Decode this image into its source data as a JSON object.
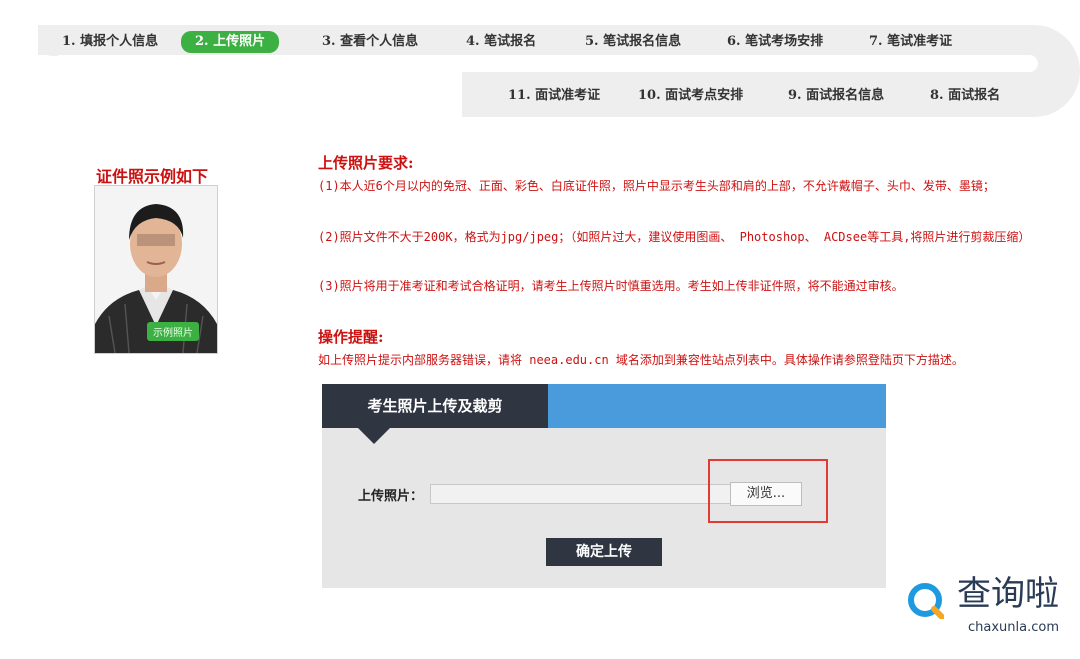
{
  "steps": [
    {
      "label": "1. 填报个人信息",
      "active": false
    },
    {
      "label": "2. 上传照片",
      "active": true
    },
    {
      "label": "3. 查看个人信息",
      "active": false
    },
    {
      "label": "4. 笔试报名",
      "active": false
    },
    {
      "label": "5. 笔试报名信息",
      "active": false
    },
    {
      "label": "6. 笔试考场安排",
      "active": false
    },
    {
      "label": "7. 笔试准考证",
      "active": false
    },
    {
      "label": "8. 面试报名",
      "active": false
    },
    {
      "label": "9. 面试报名信息",
      "active": false
    },
    {
      "label": "10. 面试考点安排",
      "active": false
    },
    {
      "label": "11. 面试准考证",
      "active": false
    }
  ],
  "sample": {
    "title": "证件照示例如下",
    "photo_label": "示例照片"
  },
  "requirements": {
    "title": "上传照片要求:",
    "items": [
      "(1)本人近6个月以内的免冠、正面、彩色、白底证件照，照片中显示考生头部和肩的上部，不允许戴帽子、头巾、发带、墨镜；",
      "(2)照片文件不大于200K，格式为jpg/jpeg；（如照片过大，建议使用图画、 Photoshop、 ACDsee等工具,将照片进行剪裁压缩）",
      "(3)照片将用于准考证和考试合格证明，请考生上传照片时慎重选用。考生如上传非证件照，将不能通过审核。"
    ]
  },
  "tip": {
    "title": "操作提醒:",
    "text": "如上传照片提示内部服务器错误，请将 neea.edu.cn 域名添加到兼容性站点列表中。具体操作请参照登陆页下方描述。"
  },
  "upload_panel": {
    "tab_title": "考生照片上传及裁剪",
    "field_label": "上传照片：",
    "file_value": "",
    "browse_label": "浏览...",
    "confirm_label": "确定上传"
  },
  "watermark": {
    "brand": "查询啦",
    "domain": "chaxunla.com"
  },
  "colors": {
    "active_step": "#3cb043",
    "warning_text": "#cc1111",
    "panel_dark": "#2f3541",
    "panel_blue": "#4a9bdc",
    "highlight": "#e53935"
  }
}
